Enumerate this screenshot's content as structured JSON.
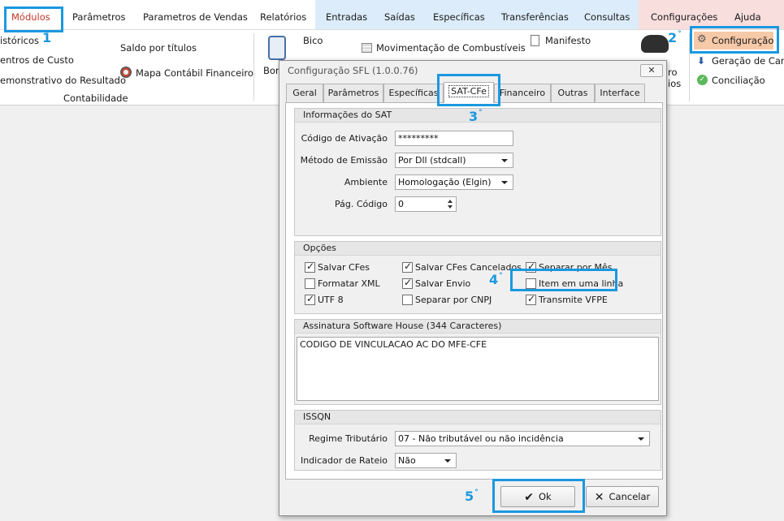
{
  "menu": {
    "modulos": "Módulos",
    "parametros": "Parâmetros",
    "parametros_vendas": "Parametros de Vendas",
    "relatorios": "Relatórios",
    "entradas": "Entradas",
    "saidas": "Saídas",
    "especificas": "Específicas",
    "transferencias": "Transferências",
    "consultas": "Consultas",
    "configuracoes": "Configurações",
    "ajuda": "Ajuda"
  },
  "ribbon": {
    "historicos": "istóricos",
    "centros_custo": "entros de Custo",
    "demonstrativo": "emonstrativo do Resultado",
    "saldo_titulos": "Saldo por títulos",
    "mapa_contabil": "Mapa Contábil Financeiro",
    "group_contabilidade": "Contabilidade",
    "bico": "Bico",
    "bor": "Bor",
    "movimentacao": "Movimentação de Combustíveis",
    "manifesto": "Manifesto",
    "ro": "ro",
    "os": "ios",
    "configuracao": "Configuração",
    "geracao_carga": "Geração de Carga",
    "conciliacao": "Conciliação"
  },
  "dialog": {
    "title": "Configuração SFL (1.0.0.76)",
    "close_label": "✕",
    "tabs": [
      "Geral",
      "Parâmetros",
      "Específicas",
      "SAT-CFe",
      "Financeiro",
      "Outras",
      "Interface"
    ],
    "active_tab": "SAT-CFe",
    "sat_info": {
      "header": "Informações do SAT",
      "codigo_ativacao_label": "Código de Ativação",
      "codigo_ativacao_value": "*********",
      "metodo_emissao_label": "Método de Emissão",
      "metodo_emissao_value": "Por Dll (stdcall)",
      "ambiente_label": "Ambiente",
      "ambiente_value": "Homologação (Elgin)",
      "pag_codigo_label": "Pág. Código",
      "pag_codigo_value": "0"
    },
    "opcoes": {
      "header": "Opções",
      "items": [
        {
          "label": "Salvar CFes",
          "checked": true
        },
        {
          "label": "Salvar CFes Cancelados",
          "checked": true
        },
        {
          "label": "Separar por Mês",
          "checked": true
        },
        {
          "label": "Formatar XML",
          "checked": false
        },
        {
          "label": "Salvar Envio",
          "checked": true
        },
        {
          "label": "Item em uma linha",
          "checked": false
        },
        {
          "label": "UTF 8",
          "checked": true
        },
        {
          "label": "Separar por CNPJ",
          "checked": false
        },
        {
          "label": "Transmite VFPE",
          "checked": true
        }
      ]
    },
    "assinatura": {
      "header": "Assinatura Software House (344 Caracteres)",
      "value": "CODIGO DE VINCULACAO AC DO MFE-CFE"
    },
    "issqn": {
      "header": "ISSQN",
      "regime_label": "Regime Tributário",
      "regime_value": "07 - Não tributável ou não incidência",
      "rateio_label": "Indicador de Rateio",
      "rateio_value": "Não"
    },
    "ok_label": "Ok",
    "cancelar_label": "Cancelar"
  },
  "annotations": [
    "1",
    "2",
    "3",
    "4",
    "5"
  ],
  "colors": {
    "highlight": "#1b98e0",
    "menu_active_text": "#c0392b",
    "band_blue": "#dcecfa",
    "band_red": "#f9dede",
    "config_active_bg": "#f6c9a8"
  }
}
